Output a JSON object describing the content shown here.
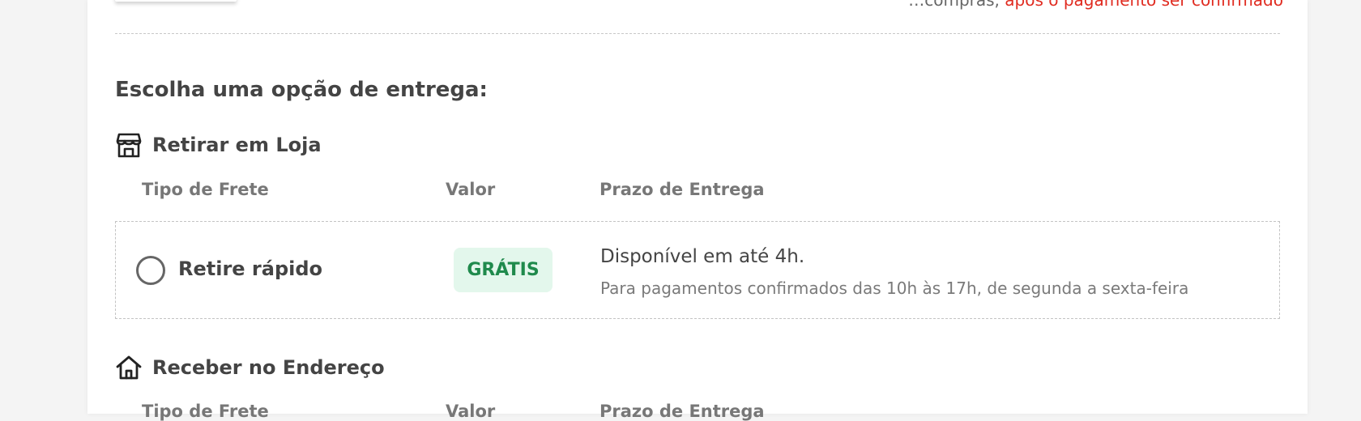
{
  "top_note": {
    "text_a": "…compras, ",
    "text_b": "após o pagamento ser confirmado"
  },
  "section_title": "Escolha uma opção de entrega:",
  "pickup": {
    "icon": "store-icon",
    "label": "Retirar em Loja",
    "columns": {
      "type": "Tipo de Frete",
      "value": "Valor",
      "deadline": "Prazo de Entrega"
    },
    "option": {
      "name": "Retire rápido",
      "price": "GRÁTIS",
      "deadline": "Disponível em até 4h.",
      "note": "Para pagamentos confirmados das 10h às 17h, de segunda a sexta-feira",
      "selected": false
    }
  },
  "delivery": {
    "icon": "home-icon",
    "label": "Receber no Endereço",
    "columns": {
      "type": "Tipo de Frete",
      "value": "Valor",
      "deadline": "Prazo de Entrega"
    }
  },
  "colors": {
    "accent_red": "#e02b20",
    "free_badge_bg": "#e3f7ec",
    "free_badge_text": "#1f8a4c"
  }
}
